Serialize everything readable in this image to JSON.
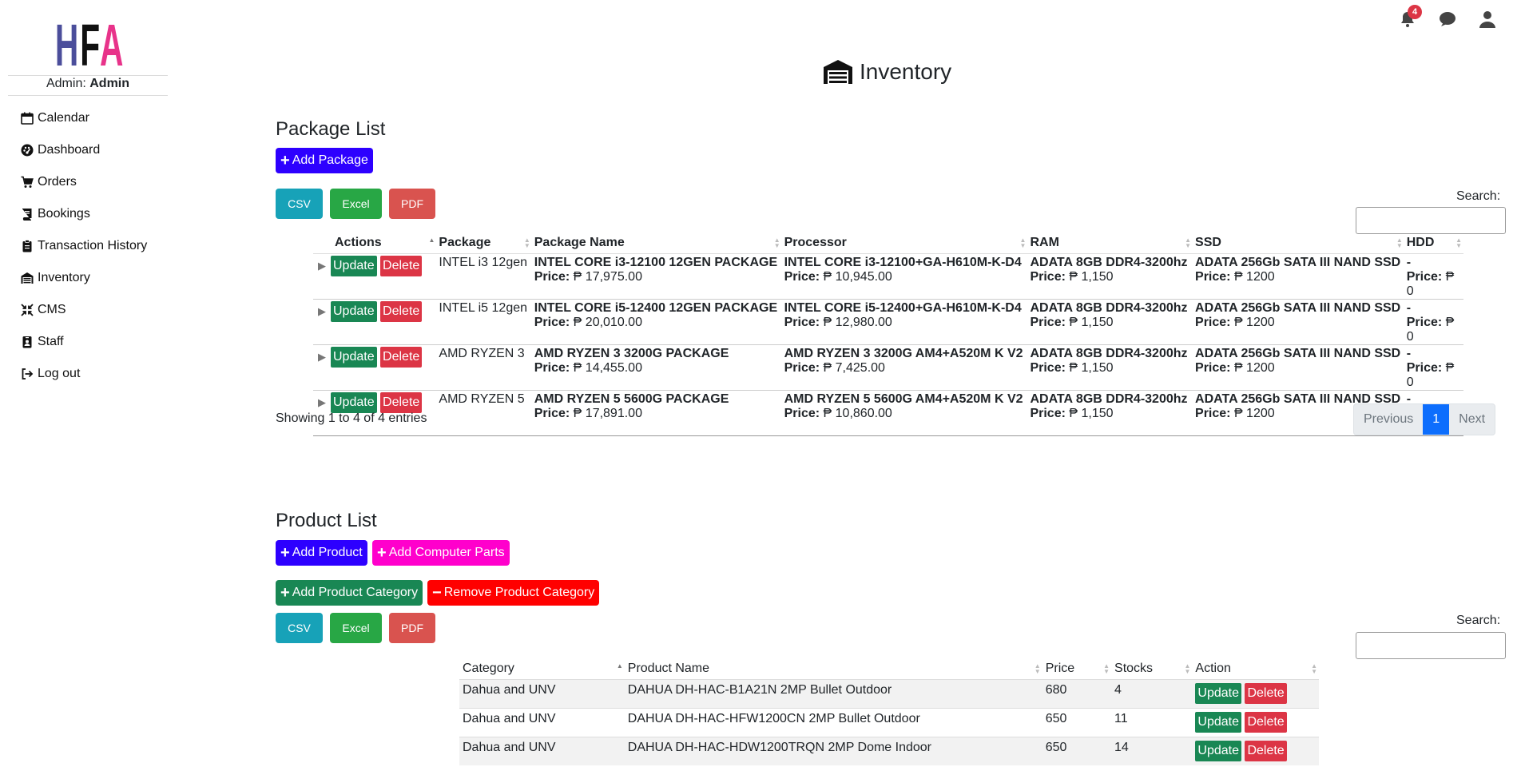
{
  "sidebar": {
    "logo_text": "HFA",
    "admin_label": "Admin:",
    "admin_name": "Admin",
    "items": [
      {
        "label": "Calendar",
        "icon": "calendar-icon"
      },
      {
        "label": "Dashboard",
        "icon": "dashboard-icon"
      },
      {
        "label": "Orders",
        "icon": "cart-icon"
      },
      {
        "label": "Bookings",
        "icon": "book-icon"
      },
      {
        "label": "Transaction History",
        "icon": "clipboard-icon"
      },
      {
        "label": "Inventory",
        "icon": "warehouse-icon"
      },
      {
        "label": "CMS",
        "icon": "compress-icon"
      },
      {
        "label": "Staff",
        "icon": "id-badge-icon"
      },
      {
        "label": "Log out",
        "icon": "logout-icon"
      }
    ]
  },
  "topbar": {
    "notification_count": "4"
  },
  "page": {
    "title": "Inventory"
  },
  "packages": {
    "title": "Package List",
    "add_button": "Add Package",
    "export": {
      "csv": "CSV",
      "excel": "Excel",
      "pdf": "PDF"
    },
    "search_label": "Search:",
    "columns": [
      "Actions",
      "Package",
      "Package Name",
      "Processor",
      "RAM",
      "SSD",
      "HDD"
    ],
    "update_label": "Update",
    "delete_label": "Delete",
    "price_label": "Price:",
    "rows": [
      {
        "package": "INTEL i3 12gen",
        "name": "INTEL CORE i3-12100 12GEN PACKAGE",
        "name_price": "₱ 17,975.00",
        "processor": "INTEL CORE i3-12100+GA-H610M-K-D4",
        "processor_price": "₱ 10,945.00",
        "ram": "ADATA 8GB DDR4-3200hz",
        "ram_price": "₱ 1,150",
        "ssd": "ADATA 256Gb SATA III NAND SSD",
        "ssd_price": "₱ 1200",
        "hdd": "-",
        "hdd_price": "₱ 0"
      },
      {
        "package": "INTEL i5 12gen",
        "name": "INTEL CORE i5-12400 12GEN PACKAGE",
        "name_price": "₱ 20,010.00",
        "processor": "INTEL CORE i5-12400+GA-H610M-K-D4",
        "processor_price": "₱ 12,980.00",
        "ram": "ADATA 8GB DDR4-3200hz",
        "ram_price": "₱ 1,150",
        "ssd": "ADATA 256Gb SATA III NAND SSD",
        "ssd_price": "₱ 1200",
        "hdd": "-",
        "hdd_price": "₱ 0"
      },
      {
        "package": "AMD RYZEN 3",
        "name": "AMD RYZEN 3 3200G PACKAGE",
        "name_price": "₱ 14,455.00",
        "processor": "AMD RYZEN 3 3200G AM4+A520M K V2",
        "processor_price": "₱ 7,425.00",
        "ram": "ADATA 8GB DDR4-3200hz",
        "ram_price": "₱ 1,150",
        "ssd": "ADATA 256Gb SATA III NAND SSD",
        "ssd_price": "₱ 1200",
        "hdd": "-",
        "hdd_price": "₱ 0"
      },
      {
        "package": "AMD RYZEN 5",
        "name": "AMD RYZEN 5 5600G PACKAGE",
        "name_price": "₱ 17,891.00",
        "processor": "AMD RYZEN 5 5600G AM4+A520M K V2",
        "processor_price": "₱ 10,860.00",
        "ram": "ADATA 8GB DDR4-3200hz",
        "ram_price": "₱ 1,150",
        "ssd": "ADATA 256Gb SATA III NAND SSD",
        "ssd_price": "₱ 1200",
        "hdd": "-",
        "hdd_price": "₱ 0"
      }
    ],
    "info": "Showing 1 to 4 of 4 entries",
    "pager": {
      "previous": "Previous",
      "page": "1",
      "next": "Next"
    }
  },
  "products": {
    "title": "Product List",
    "add_product": "Add Product",
    "add_parts": "Add Computer Parts",
    "add_category": "Add Product Category",
    "remove_category": "Remove Product Category",
    "export": {
      "csv": "CSV",
      "excel": "Excel",
      "pdf": "PDF"
    },
    "search_label": "Search:",
    "columns": [
      "Category",
      "Product Name",
      "Price",
      "Stocks",
      "Action"
    ],
    "update_label": "Update",
    "delete_label": "Delete",
    "rows": [
      {
        "category": "Dahua and UNV",
        "name": "DAHUA DH-HAC-B1A21N 2MP Bullet Outdoor",
        "price": "680",
        "stocks": "4"
      },
      {
        "category": "Dahua and UNV",
        "name": "DAHUA DH-HAC-HFW1200CN 2MP Bullet Outdoor",
        "price": "650",
        "stocks": "11"
      },
      {
        "category": "Dahua and UNV",
        "name": "DAHUA DH-HAC-HDW1200TRQN 2MP Dome Indoor",
        "price": "650",
        "stocks": "14"
      }
    ]
  },
  "colors": {
    "add_blue": "#2d00ff",
    "magenta": "#ff00cc",
    "green": "#198754",
    "red": "#ff0000",
    "csv": "#17a2b8",
    "excel": "#28a745",
    "pdf": "#d9534f"
  }
}
